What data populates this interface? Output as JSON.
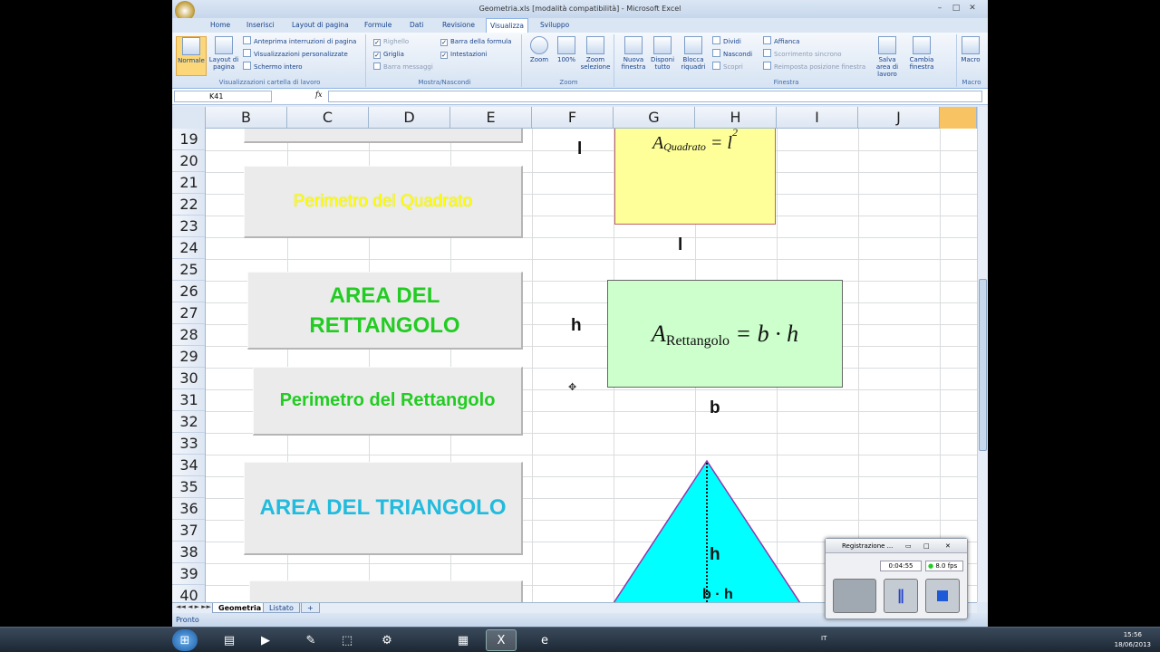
{
  "window": {
    "title": "Geometria.xls  [modalità compatibilità] - Microsoft Excel"
  },
  "tabs": [
    "Home",
    "Inserisci",
    "Layout di pagina",
    "Formule",
    "Dati",
    "Revisione",
    "Visualizza",
    "Sviluppo"
  ],
  "ribbon": {
    "views": {
      "normale": "Normale",
      "layout": "Layout di pagina",
      "anteprima": "Anteprima interruzioni di pagina",
      "personalizzate": "Visualizzazioni personalizzate",
      "schermo": "Schermo intero",
      "title": "Visualizzazioni cartella di lavoro"
    },
    "show": {
      "righello": "Righello",
      "griglia": "Griglia",
      "barra_messaggi": "Barra messaggi",
      "barra_formula": "Barra della formula",
      "intestazioni": "Intestazioni",
      "title": "Mostra/Nascondi"
    },
    "zoom": {
      "zoom": "Zoom",
      "cento": "100%",
      "selezione": "Zoom selezione",
      "title": "Zoom"
    },
    "finestra": {
      "nuova": "Nuova finestra",
      "disponi": "Disponi tutto",
      "blocca": "Blocca riquadri",
      "dividi": "Dividi",
      "nascondi": "Nascondi",
      "scopri": "Scopri",
      "affianca": "Affianca",
      "scorrimento": "Scorrimento sincrono",
      "reimposta": "Reimposta posizione finestra",
      "salva": "Salva area di lavoro",
      "cambia": "Cambia finestra",
      "title": "Finestra"
    },
    "macro": {
      "label": "Macro",
      "title": "Macro"
    }
  },
  "formula_bar": {
    "name_box": "K41",
    "fx": "fx"
  },
  "columns": [
    "B",
    "C",
    "D",
    "E",
    "F",
    "G",
    "H",
    "I",
    "J"
  ],
  "rows": [
    "19",
    "20",
    "21",
    "22",
    "23",
    "24",
    "25",
    "26",
    "27",
    "28",
    "29",
    "30",
    "31",
    "32",
    "33",
    "34",
    "35",
    "36",
    "37",
    "38",
    "39",
    "40"
  ],
  "shapes": {
    "perimetro_quadrato": "Perimetro del Quadrato",
    "area_rettangolo": "AREA DEL RETTANGOLO",
    "perimetro_rettangolo": "Perimetro del Rettangolo",
    "area_triangolo": "AREA DEL TRIANGOLO"
  },
  "labels": {
    "l1": "l",
    "l2": "l",
    "h1": "h",
    "b": "b",
    "h2": "h",
    "bh": "b · h"
  },
  "formulas": {
    "quadrato": "A",
    "quadrato_sub": "Quadrato",
    "quadrato_rhs": "= l",
    "quadrato_exp": "2",
    "rett": "A",
    "rett_sub": "Rettangolo",
    "rett_rhs": "= b · h"
  },
  "sheets": [
    "Geometria",
    "Listato"
  ],
  "status": "Pronto",
  "recorder": {
    "title": "Registrazione ...",
    "time": "0:04:55",
    "fps": "8.0 fps"
  },
  "clock": {
    "time": "15:56",
    "date": "18/06/2013",
    "lang": "IT"
  },
  "colors": {
    "yellow_text": "#ffff00",
    "green_text": "#22cc22",
    "cyan_text": "#22bbdd",
    "yellow_fill": "#ffff99",
    "green_fill": "#ccffcc",
    "triangle_fill": "#00ffff"
  }
}
